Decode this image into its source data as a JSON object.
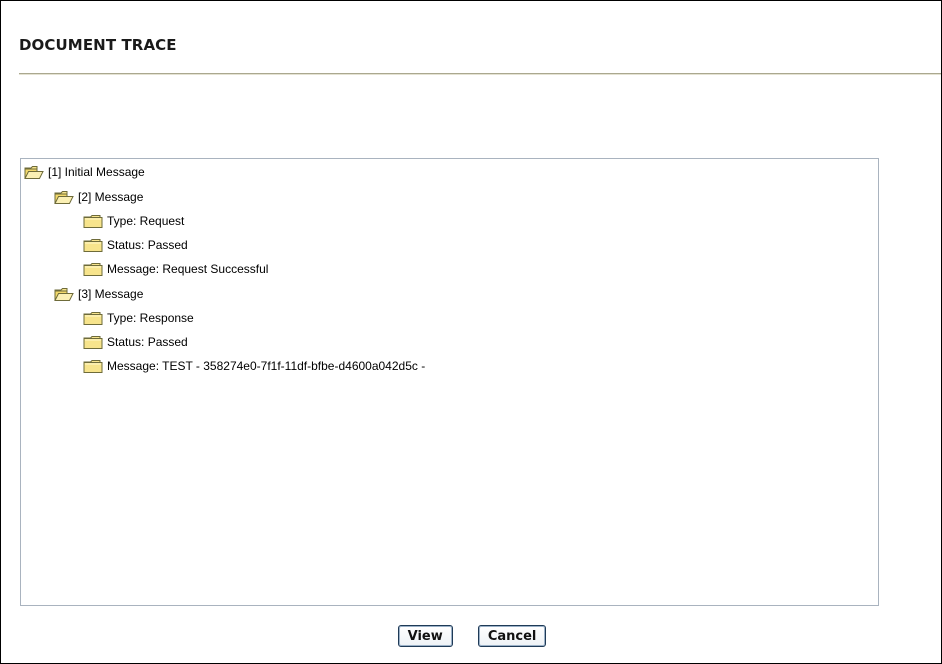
{
  "page": {
    "title": "DOCUMENT TRACE"
  },
  "tree": {
    "nodes": [
      {
        "label": "[1] Initial Message",
        "level": 0,
        "icon": "folder-open-icon"
      },
      {
        "label": "[2] Message",
        "level": 1,
        "icon": "folder-open-icon"
      },
      {
        "label": "Type: Request",
        "level": 2,
        "icon": "folder-closed-icon"
      },
      {
        "label": "Status: Passed",
        "level": 2,
        "icon": "folder-closed-icon"
      },
      {
        "label": "Message: Request Successful",
        "level": 2,
        "icon": "folder-closed-icon"
      },
      {
        "label": "[3] Message",
        "level": 1,
        "icon": "folder-open-icon"
      },
      {
        "label": "Type: Response",
        "level": 2,
        "icon": "folder-closed-icon"
      },
      {
        "label": "Status: Passed",
        "level": 2,
        "icon": "folder-closed-icon"
      },
      {
        "label": "Message: TEST - 358274e0-7f1f-11df-bfbe-d4600a042d5c -",
        "level": 2,
        "icon": "folder-closed-icon"
      }
    ]
  },
  "buttons": {
    "view_label": "View",
    "cancel_label": "Cancel"
  },
  "colors": {
    "folder_fill": "#f7e48c",
    "folder_stroke": "#6e6b3a",
    "panel_border": "#a9b3bf",
    "rule": "#aaa88f"
  }
}
